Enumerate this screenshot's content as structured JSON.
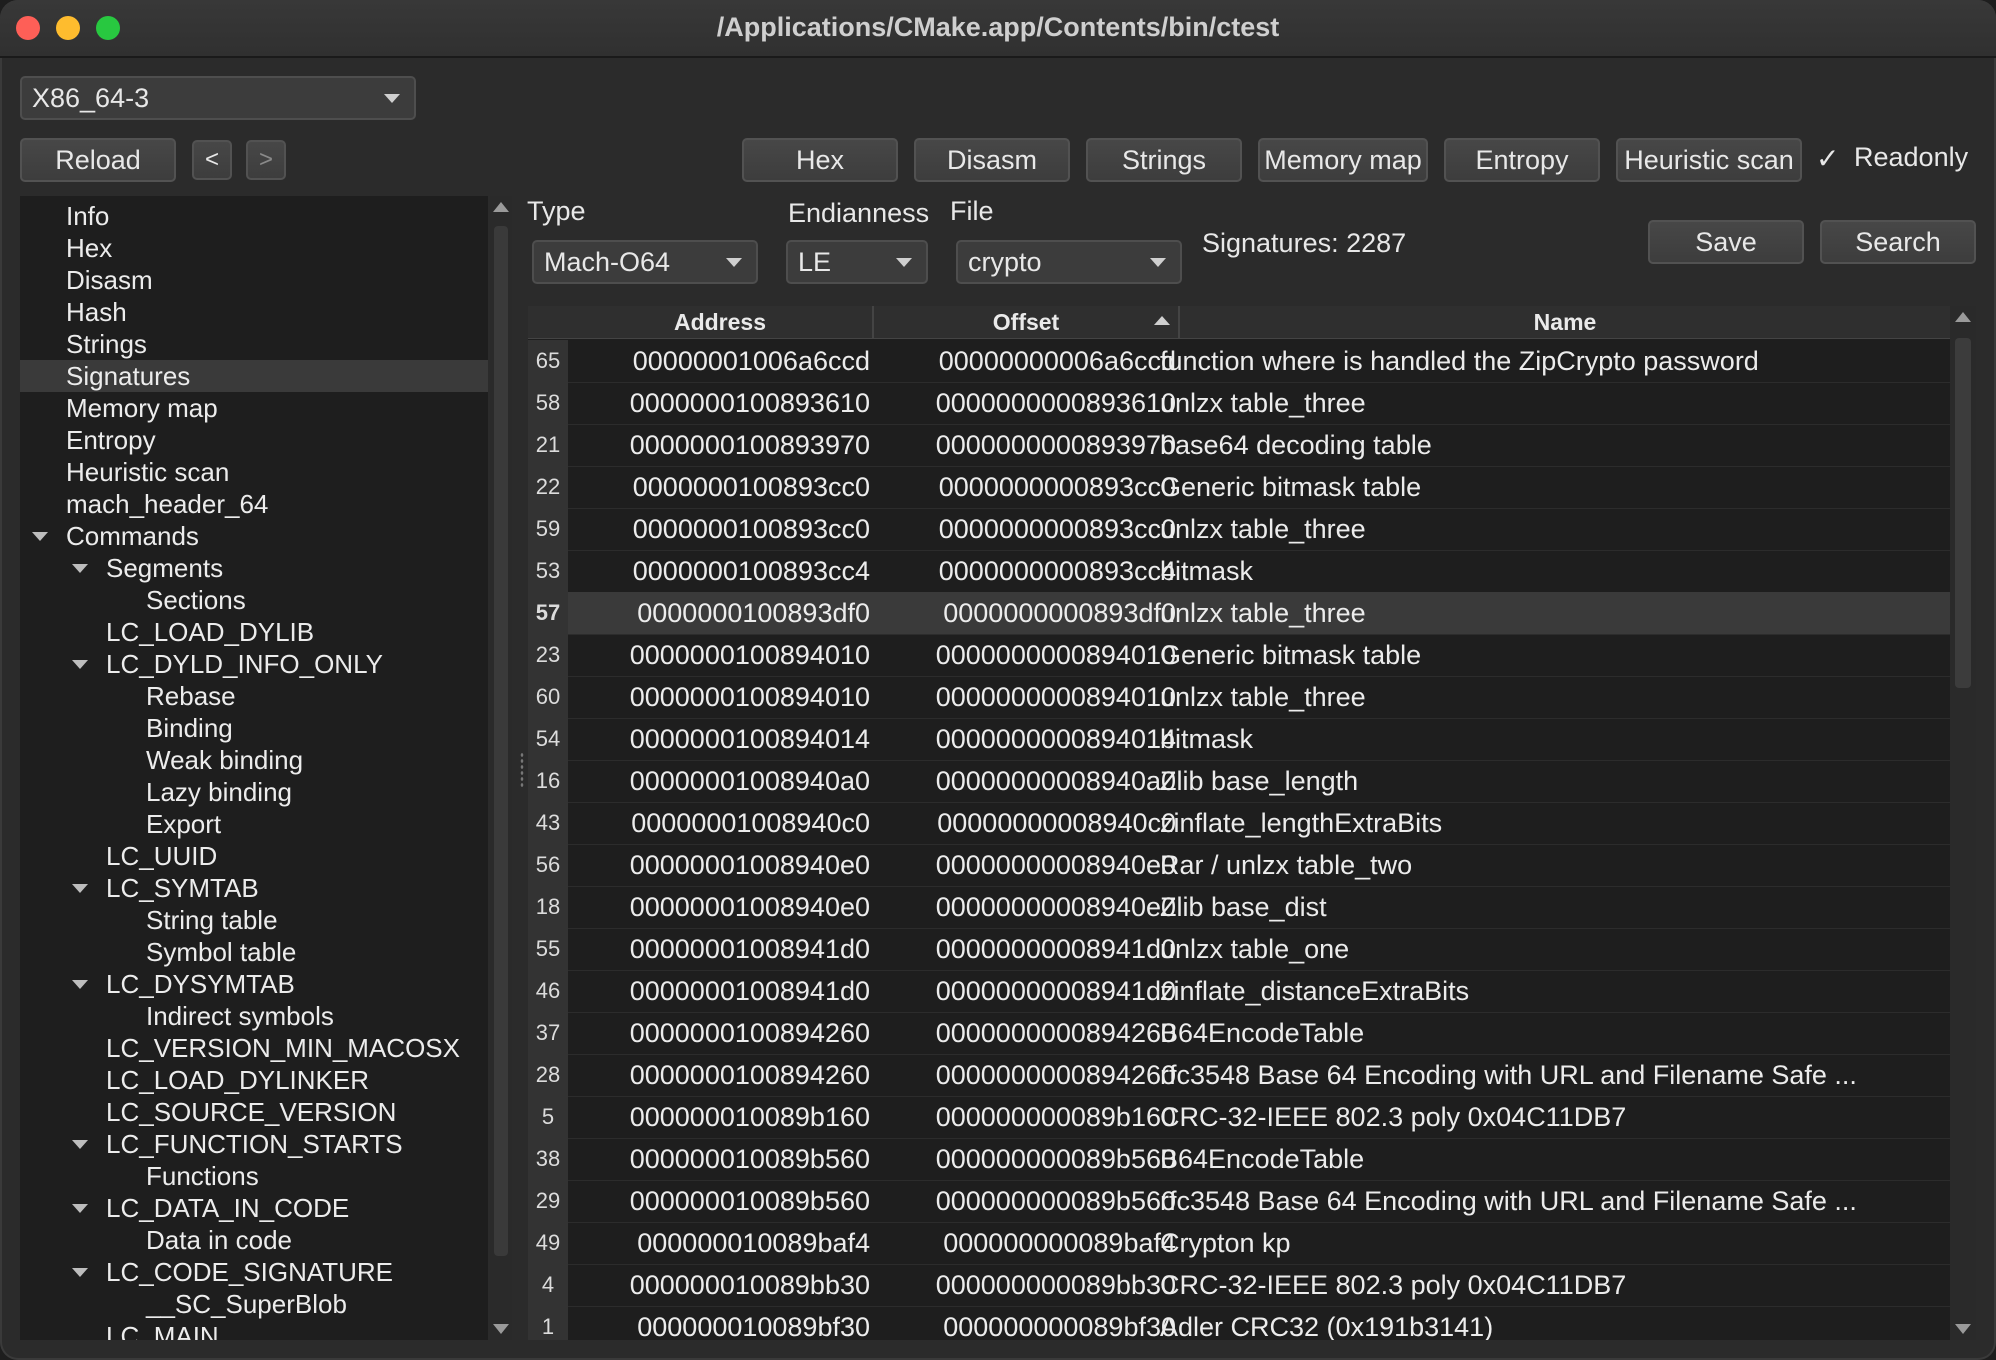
{
  "window": {
    "title": "/Applications/CMake.app/Contents/bin/ctest"
  },
  "arch_combo": {
    "value": "X86_64-3"
  },
  "toolbar": {
    "reload": "Reload",
    "back": "<",
    "forward": ">",
    "hex": "Hex",
    "disasm": "Disasm",
    "strings": "Strings",
    "memory_map": "Memory map",
    "entropy": "Entropy",
    "heuristic_scan": "Heuristic scan",
    "readonly_label": "Readonly",
    "readonly_checked": true
  },
  "tree": {
    "items": [
      {
        "label": "Info",
        "level": 0
      },
      {
        "label": "Hex",
        "level": 0
      },
      {
        "label": "Disasm",
        "level": 0
      },
      {
        "label": "Hash",
        "level": 0
      },
      {
        "label": "Strings",
        "level": 0
      },
      {
        "label": "Signatures",
        "level": 0,
        "selected": true
      },
      {
        "label": "Memory map",
        "level": 0
      },
      {
        "label": "Entropy",
        "level": 0
      },
      {
        "label": "Heuristic scan",
        "level": 0
      },
      {
        "label": "mach_header_64",
        "level": 0
      },
      {
        "label": "Commands",
        "level": 0,
        "expanded": true
      },
      {
        "label": "Segments",
        "level": 1,
        "expanded": true
      },
      {
        "label": "Sections",
        "level": 2
      },
      {
        "label": "LC_LOAD_DYLIB",
        "level": 1
      },
      {
        "label": "LC_DYLD_INFO_ONLY",
        "level": 1,
        "expanded": true
      },
      {
        "label": "Rebase",
        "level": 2
      },
      {
        "label": "Binding",
        "level": 2
      },
      {
        "label": "Weak binding",
        "level": 2
      },
      {
        "label": "Lazy binding",
        "level": 2
      },
      {
        "label": "Export",
        "level": 2
      },
      {
        "label": "LC_UUID",
        "level": 1
      },
      {
        "label": "LC_SYMTAB",
        "level": 1,
        "expanded": true
      },
      {
        "label": "String table",
        "level": 2
      },
      {
        "label": "Symbol table",
        "level": 2
      },
      {
        "label": "LC_DYSYMTAB",
        "level": 1,
        "expanded": true
      },
      {
        "label": "Indirect symbols",
        "level": 2
      },
      {
        "label": "LC_VERSION_MIN_MACOSX",
        "level": 1
      },
      {
        "label": "LC_LOAD_DYLINKER",
        "level": 1
      },
      {
        "label": "LC_SOURCE_VERSION",
        "level": 1
      },
      {
        "label": "LC_FUNCTION_STARTS",
        "level": 1,
        "expanded": true
      },
      {
        "label": "Functions",
        "level": 2
      },
      {
        "label": "LC_DATA_IN_CODE",
        "level": 1,
        "expanded": true
      },
      {
        "label": "Data in code",
        "level": 2
      },
      {
        "label": "LC_CODE_SIGNATURE",
        "level": 1,
        "expanded": true
      },
      {
        "label": "__SC_SuperBlob",
        "level": 2
      },
      {
        "label": "LC_MAIN",
        "level": 1
      }
    ]
  },
  "filters": {
    "type_label": "Type",
    "type_value": "Mach-O64",
    "endianness_label": "Endianness",
    "endianness_value": "LE",
    "file_label": "File",
    "file_value": "crypto",
    "signatures_count": "Signatures: 2287",
    "save": "Save",
    "search": "Search"
  },
  "table": {
    "columns": [
      "Address",
      "Offset",
      "Name"
    ],
    "rows": [
      {
        "idx": "65",
        "address": "00000001006a6ccd",
        "offset": "00000000006a6ccd",
        "name": "function where is handled the ZipCrypto password"
      },
      {
        "idx": "58",
        "address": "0000000100893610",
        "offset": "0000000000893610",
        "name": "unlzx table_three"
      },
      {
        "idx": "21",
        "address": "0000000100893970",
        "offset": "0000000000893970",
        "name": "base64 decoding table"
      },
      {
        "idx": "22",
        "address": "0000000100893cc0",
        "offset": "0000000000893cc0",
        "name": "Generic bitmask table"
      },
      {
        "idx": "59",
        "address": "0000000100893cc0",
        "offset": "0000000000893cc0",
        "name": "unlzx table_three"
      },
      {
        "idx": "53",
        "address": "0000000100893cc4",
        "offset": "0000000000893cc4",
        "name": "bitmask"
      },
      {
        "idx": "57",
        "address": "0000000100893df0",
        "offset": "0000000000893df0",
        "name": "unlzx table_three",
        "selected": true
      },
      {
        "idx": "23",
        "address": "0000000100894010",
        "offset": "0000000000894010",
        "name": "Generic bitmask table"
      },
      {
        "idx": "60",
        "address": "0000000100894010",
        "offset": "0000000000894010",
        "name": "unlzx table_three"
      },
      {
        "idx": "54",
        "address": "0000000100894014",
        "offset": "0000000000894014",
        "name": "bitmask"
      },
      {
        "idx": "16",
        "address": "00000001008940a0",
        "offset": "00000000008940a0",
        "name": "Zlib base_length"
      },
      {
        "idx": "43",
        "address": "00000001008940c0",
        "offset": "00000000008940c0",
        "name": "zinflate_lengthExtraBits"
      },
      {
        "idx": "56",
        "address": "00000001008940e0",
        "offset": "00000000008940e0",
        "name": "Rar / unlzx table_two"
      },
      {
        "idx": "18",
        "address": "00000001008940e0",
        "offset": "00000000008940e0",
        "name": "Zlib base_dist"
      },
      {
        "idx": "55",
        "address": "00000001008941d0",
        "offset": "00000000008941d0",
        "name": "unlzx table_one"
      },
      {
        "idx": "46",
        "address": "00000001008941d0",
        "offset": "00000000008941d0",
        "name": "zinflate_distanceExtraBits"
      },
      {
        "idx": "37",
        "address": "0000000100894260",
        "offset": "0000000000894260",
        "name": "B64EncodeTable"
      },
      {
        "idx": "28",
        "address": "0000000100894260",
        "offset": "0000000000894260",
        "name": "rfc3548 Base 64 Encoding with URL and Filename Safe ..."
      },
      {
        "idx": "5",
        "address": "000000010089b160",
        "offset": "000000000089b160",
        "name": "CRC-32-IEEE 802.3 poly 0x04C11DB7"
      },
      {
        "idx": "38",
        "address": "000000010089b560",
        "offset": "000000000089b560",
        "name": "B64EncodeTable"
      },
      {
        "idx": "29",
        "address": "000000010089b560",
        "offset": "000000000089b560",
        "name": "rfc3548 Base 64 Encoding with URL and Filename Safe ..."
      },
      {
        "idx": "49",
        "address": "000000010089baf4",
        "offset": "000000000089baf4",
        "name": "Crypton kp"
      },
      {
        "idx": "4",
        "address": "000000010089bb30",
        "offset": "000000000089bb30",
        "name": "CRC-32-IEEE 802.3 poly 0x04C11DB7"
      },
      {
        "idx": "1",
        "address": "000000010089bf30",
        "offset": "000000000089bf30",
        "name": "Adler CRC32 (0x191b3141)"
      }
    ]
  }
}
